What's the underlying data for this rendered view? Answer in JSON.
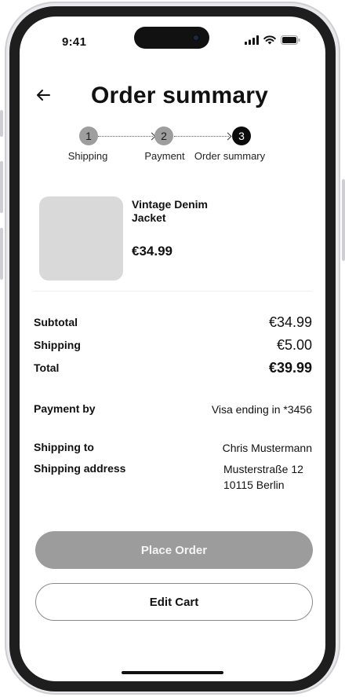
{
  "status_bar": {
    "time": "9:41"
  },
  "header": {
    "title": "Order summary"
  },
  "stepper": {
    "steps": [
      {
        "number": "1",
        "label": "Shipping",
        "state": "done"
      },
      {
        "number": "2",
        "label": "Payment",
        "state": "done"
      },
      {
        "number": "3",
        "label": "Order summary",
        "state": "current"
      }
    ]
  },
  "product": {
    "name": "Vintage Denim Jacket",
    "price": "€34.99"
  },
  "summary": {
    "subtotal_label": "Subtotal",
    "subtotal_value": "€34.99",
    "shipping_label": "Shipping",
    "shipping_value": "€5.00",
    "total_label": "Total",
    "total_value": "€39.99"
  },
  "payment": {
    "label": "Payment by",
    "value": "Visa ending in *3456"
  },
  "shipping_to": {
    "label": "Shipping to",
    "name": "Chris Mustermann",
    "address_label": "Shipping address",
    "address_line1": "Musterstraße 12",
    "address_line2": "10115 Berlin"
  },
  "actions": {
    "place_order": "Place Order",
    "edit_cart": "Edit Cart"
  },
  "colors": {
    "step_inactive": "#9e9e9e",
    "step_active": "#0b0b0b",
    "primary_button_disabled": "#9c9c9c",
    "image_placeholder": "#d9d9d9"
  }
}
